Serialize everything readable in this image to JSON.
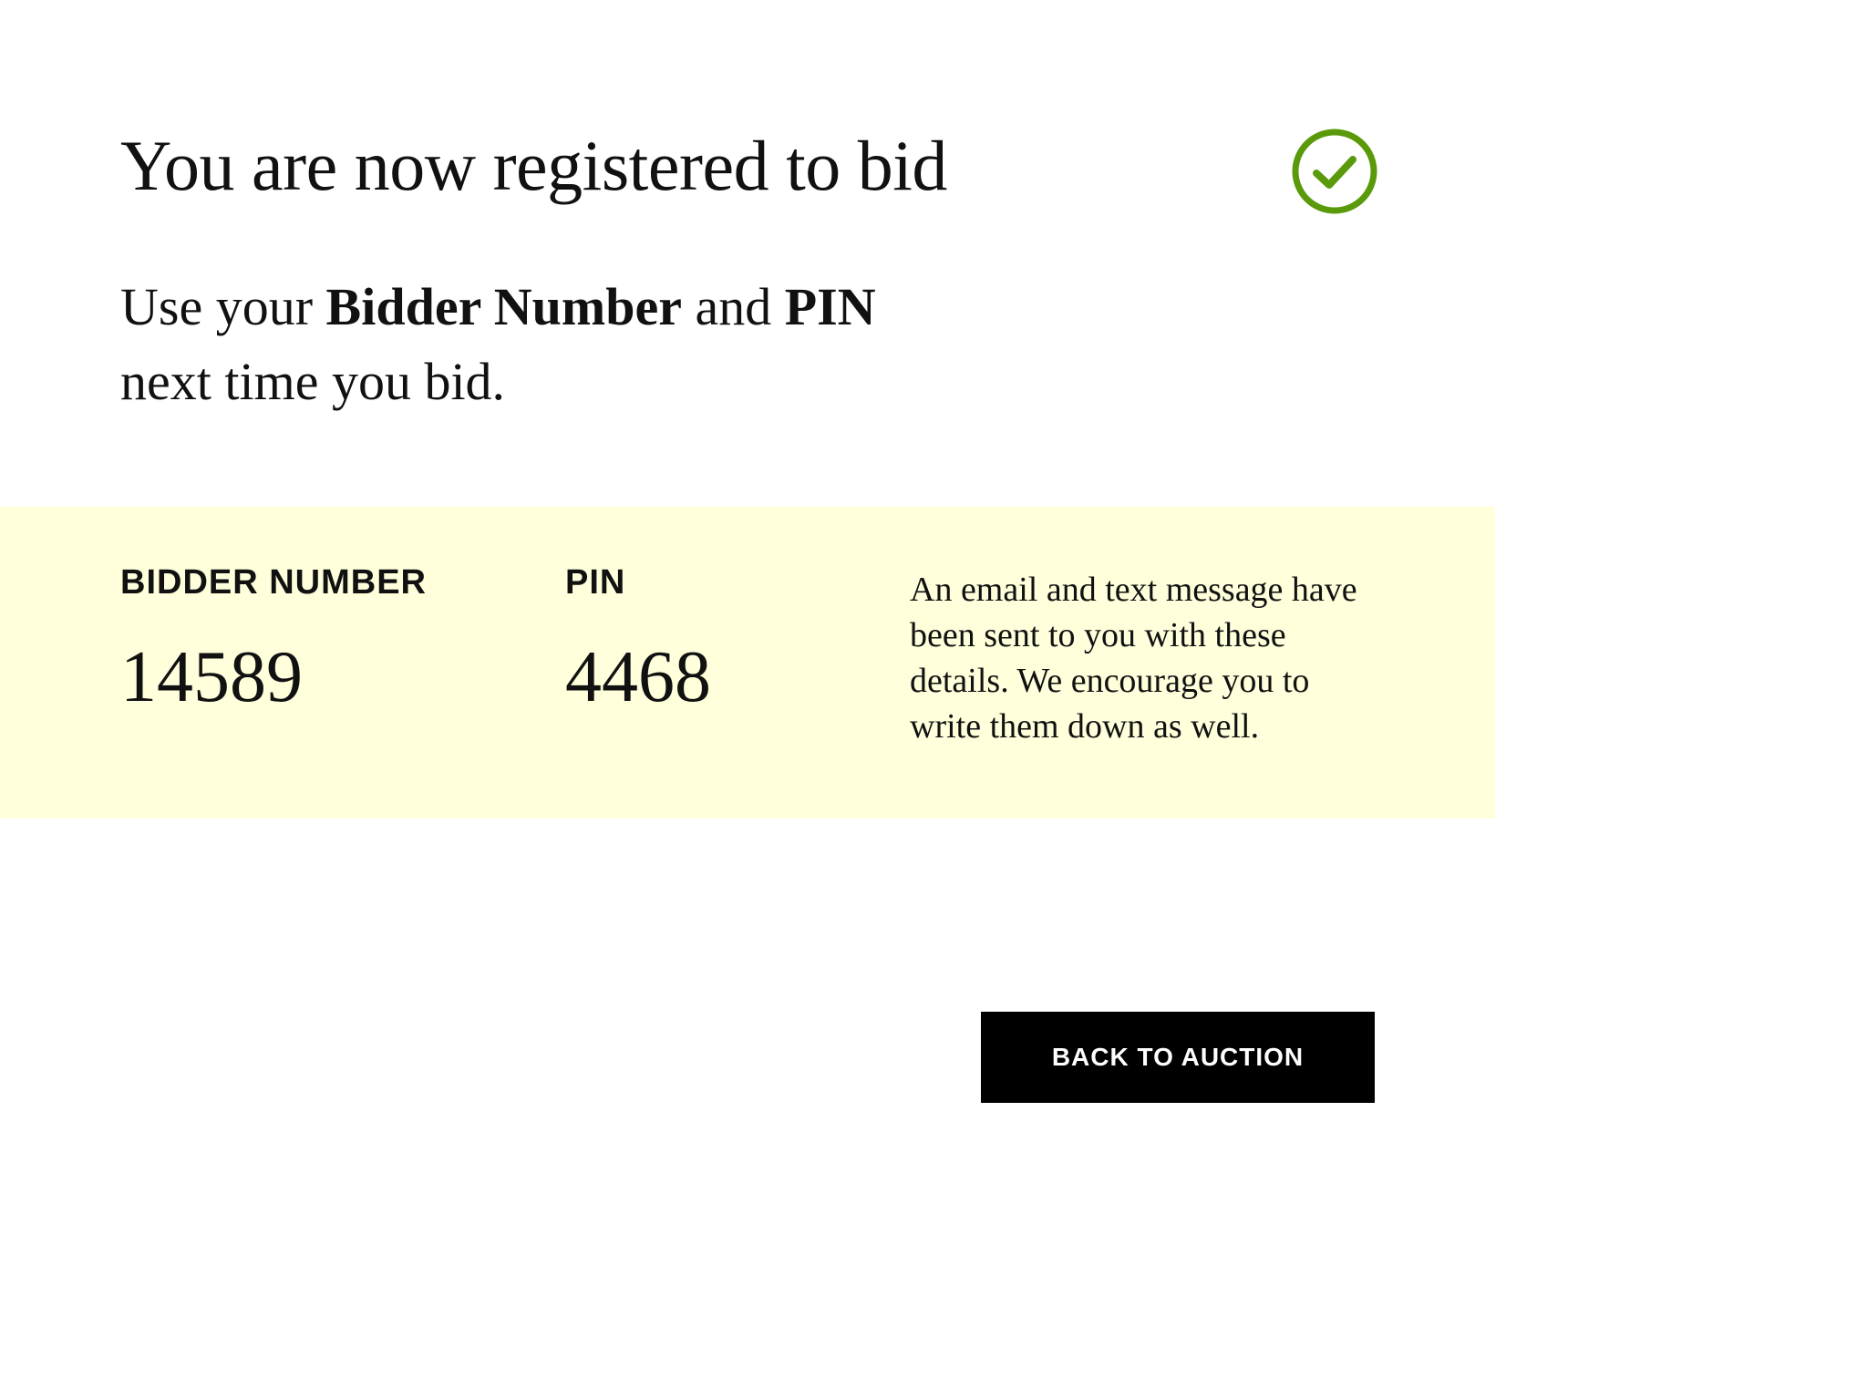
{
  "header": {
    "title": "You are now registered to bid",
    "status_icon": "check-circle-icon",
    "status_color": "#5a9a0a"
  },
  "intro": {
    "prefix": "Use your ",
    "bidder_number_term": "Bidder Number",
    "middle": " and ",
    "pin_term": "PIN",
    "suffix": "next time you bid."
  },
  "details": {
    "background_color": "#ffffdb",
    "bidder_number_label": "BIDDER NUMBER",
    "bidder_number_value": "14589",
    "pin_label": "PIN",
    "pin_value": "4468",
    "notice": "An email and text message have been sent to you with these details. We encourage you to write them down as well."
  },
  "actions": {
    "back_label": "BACK TO AUCTION"
  }
}
